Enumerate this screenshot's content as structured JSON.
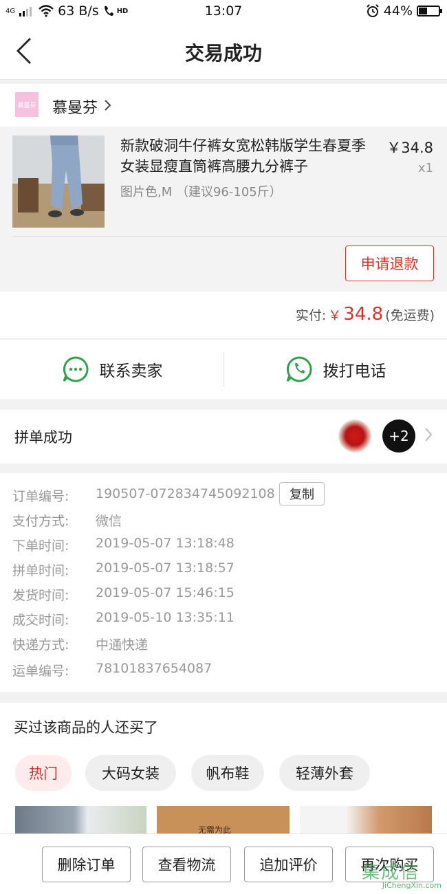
{
  "status_bar": {
    "signal": "4G",
    "speed": "63 B/s",
    "hd": "HD",
    "time": "13:07",
    "battery": "44%",
    "battery_level": 0.44
  },
  "header": {
    "title": "交易成功"
  },
  "shop": {
    "logo_text": "慕曼芬",
    "name": "慕曼芬"
  },
  "product": {
    "title": "新款破洞牛仔裤女宽松韩版学生春夏季女装显瘦直筒裤高腰九分裤子",
    "spec": "图片色,M （建议96-105斤）",
    "price": "￥34.8",
    "qty": "x1",
    "refund_label": "申请退款"
  },
  "payment": {
    "paid_label": "实付:",
    "currency": "￥",
    "amount": "34.8",
    "shipping_note": "(免运费)"
  },
  "contact": {
    "seller_label": "联系卖家",
    "phone_label": "拨打电话"
  },
  "group": {
    "label": "拼单成功",
    "more_count": "+2"
  },
  "order_info": {
    "copy_label": "复制",
    "rows": [
      {
        "key": "订单编号:",
        "value": "190507-072834745092108"
      },
      {
        "key": "支付方式:",
        "value": "微信"
      },
      {
        "key": "下单时间:",
        "value": "2019-05-07 13:18:48"
      },
      {
        "key": "拼单时间:",
        "value": "2019-05-07 13:18:57"
      },
      {
        "key": "发货时间:",
        "value": "2019-05-07 15:46:15"
      },
      {
        "key": "成交时间:",
        "value": "2019-05-10 13:35:11"
      },
      {
        "key": "快递方式:",
        "value": "中通快递"
      },
      {
        "key": "运单编号:",
        "value": "78101837654087"
      }
    ]
  },
  "recommend": {
    "title": "买过该商品的人还买了",
    "tabs": [
      "热门",
      "大码女装",
      "帆布鞋",
      "轻薄外套"
    ],
    "thumb_text": "无需为此"
  },
  "bottom_actions": {
    "delete": "删除订单",
    "logistics": "查看物流",
    "review": "追加评价",
    "rebuy": "再次购买"
  },
  "watermark": {
    "cn": "集成信",
    "en": "JiChengXin.com"
  },
  "colors": {
    "accent": "#e02e24",
    "green": "#3cb371"
  }
}
